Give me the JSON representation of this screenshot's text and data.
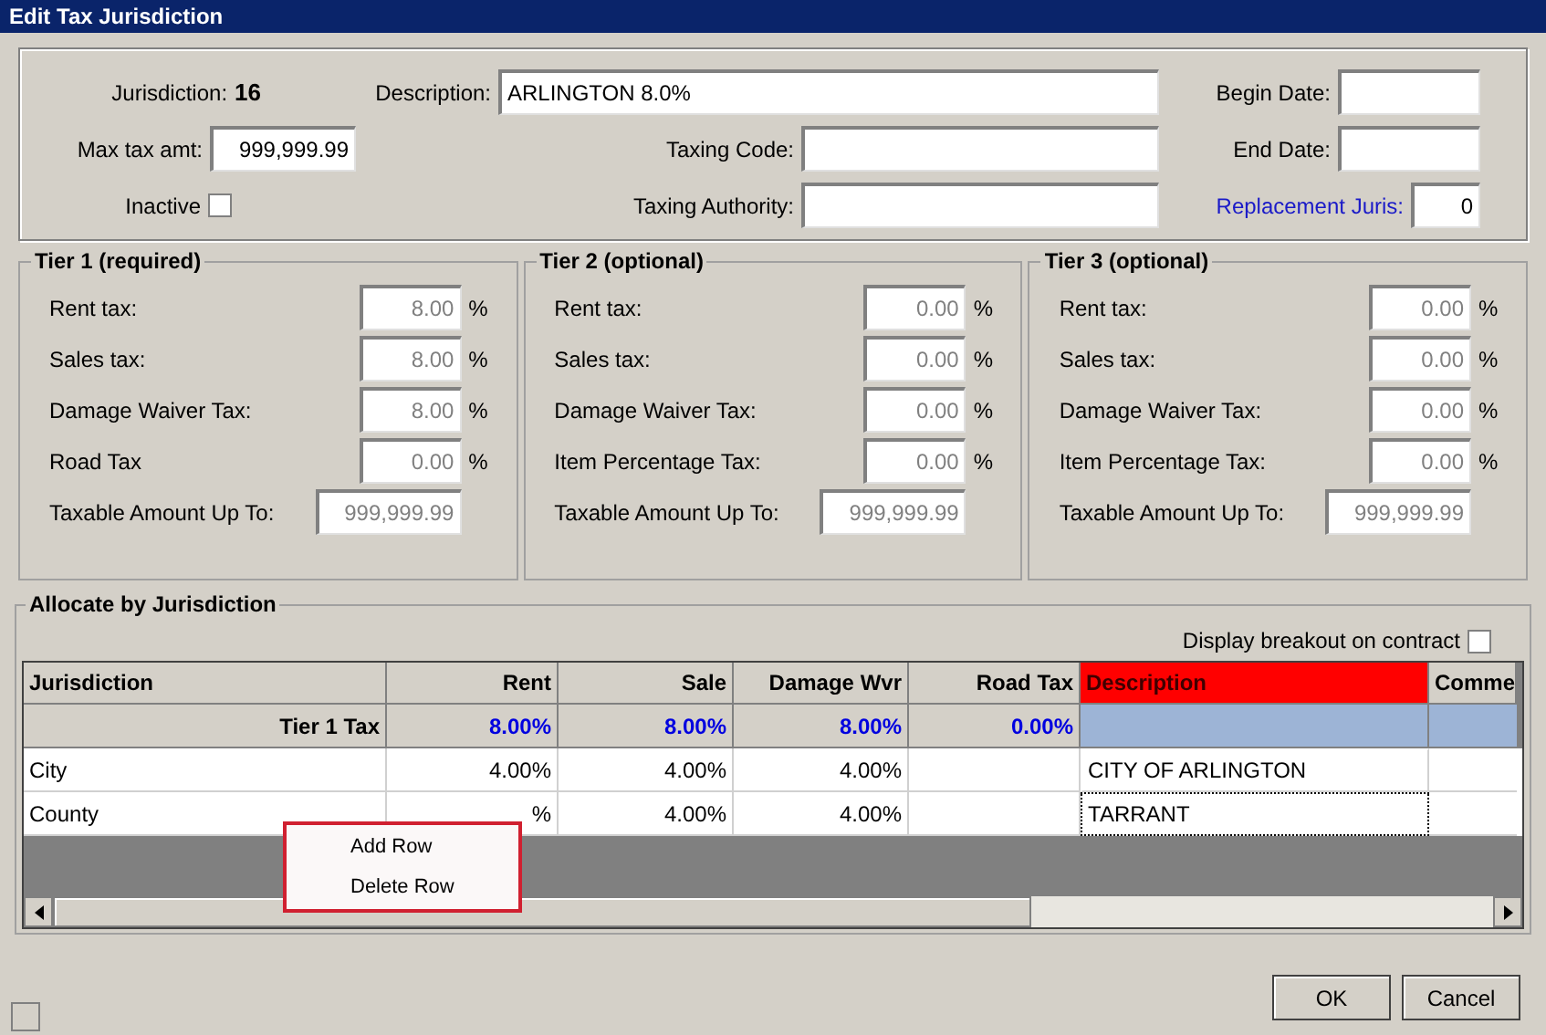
{
  "window": {
    "title": "Edit Tax Jurisdiction"
  },
  "header": {
    "jurisdiction_label": "Jurisdiction:",
    "jurisdiction_value": "16",
    "max_tax": {
      "label": "Max tax amt:",
      "value": "999,999.99"
    },
    "inactive": {
      "label": "Inactive",
      "checked": false
    },
    "middle_fields": [
      {
        "label": "Description:",
        "value": "ARLINGTON 8.0%",
        "kind": "wide"
      },
      {
        "label": "Taxing Code:",
        "kind": "narrow"
      },
      {
        "label": "Taxing Authority:",
        "kind": "narrow"
      }
    ],
    "right_fields": [
      {
        "label": "Begin Date:",
        "link": false,
        "kind": "date"
      },
      {
        "label": "End Date:",
        "link": false,
        "kind": "date"
      },
      {
        "label": "Replacement Juris:",
        "value": "0",
        "link": true,
        "kind": "small"
      }
    ]
  },
  "tiers": [
    {
      "title": "Tier 1 (required)",
      "fields": [
        {
          "label": "Rent tax:",
          "value": "8.00",
          "unit": "%",
          "disabled": true
        },
        {
          "label": "Sales tax:",
          "value": "8.00",
          "unit": "%",
          "disabled": true
        },
        {
          "label": "Damage Waiver Tax:",
          "value": "8.00",
          "unit": "%",
          "disabled": true
        },
        {
          "label": "Road Tax",
          "value": "0.00",
          "unit": "%",
          "disabled": true
        },
        {
          "label": "Taxable Amount Up To:",
          "value": "999,999.99",
          "disabled": true
        }
      ]
    },
    {
      "title": "Tier 2 (optional)",
      "fields": [
        {
          "label": "Rent tax:",
          "value": "0.00",
          "unit": "%",
          "disabled": true
        },
        {
          "label": "Sales tax:",
          "value": "0.00",
          "unit": "%",
          "disabled": true
        },
        {
          "label": "Damage Waiver Tax:",
          "value": "0.00",
          "unit": "%",
          "disabled": true
        },
        {
          "label": "Item Percentage Tax:",
          "value": "0.00",
          "unit": "%",
          "disabled": true
        },
        {
          "label": "Taxable Amount Up To:",
          "value": "999,999.99",
          "disabled": true
        }
      ]
    },
    {
      "title": "Tier 3 (optional)",
      "fields": [
        {
          "label": "Rent tax:",
          "value": "0.00",
          "unit": "%",
          "disabled": true
        },
        {
          "label": "Sales tax:",
          "value": "0.00",
          "unit": "%",
          "disabled": true
        },
        {
          "label": "Damage Waiver Tax:",
          "value": "0.00",
          "unit": "%",
          "disabled": true
        },
        {
          "label": "Item Percentage Tax:",
          "value": "0.00",
          "unit": "%",
          "disabled": true
        },
        {
          "label": "Taxable Amount Up To:",
          "value": "999,999.99",
          "disabled": true
        }
      ]
    }
  ],
  "allocate": {
    "title": "Allocate by Jurisdiction",
    "breakout": {
      "label": "Display breakout on contract",
      "checked": false
    },
    "columns": [
      {
        "label": "Jurisdiction",
        "selected": false
      },
      {
        "label": "Rent",
        "selected": false
      },
      {
        "label": "Sale",
        "selected": false
      },
      {
        "label": "Damage Wvr",
        "selected": false
      },
      {
        "label": "Road Tax",
        "selected": false
      },
      {
        "label": "Description",
        "selected": true
      },
      {
        "label": "Comme",
        "selected": false
      }
    ],
    "tier_row": {
      "label": "Tier 1 Tax",
      "rent": "8.00%",
      "sale": "8.00%",
      "damage_wvr": "8.00%",
      "road_tax": "0.00%"
    },
    "rows": [
      {
        "jurisdiction": "City",
        "rent": "4.00%",
        "sale": "4.00%",
        "damage_wvr": "4.00%",
        "description": "CITY OF ARLINGTON",
        "focused": false
      },
      {
        "jurisdiction": "County",
        "rent": "%",
        "sale": "4.00%",
        "damage_wvr": "4.00%",
        "description": "TARRANT",
        "focused": true
      }
    ],
    "context_menu": [
      "Add Row",
      "Delete Row"
    ]
  },
  "buttons": [
    "OK",
    "Cancel"
  ]
}
